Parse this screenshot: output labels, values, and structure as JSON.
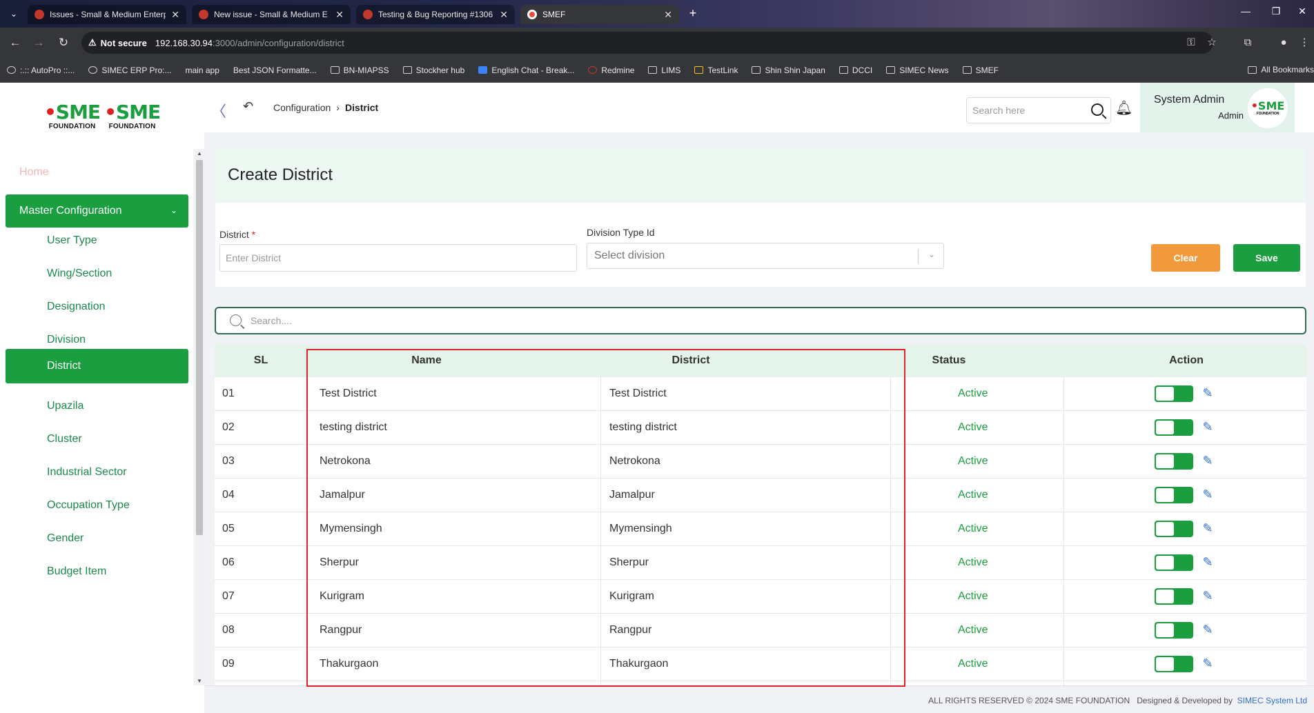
{
  "browser": {
    "tabs": [
      {
        "title": "Issues - Small & Medium Enterp",
        "active": false
      },
      {
        "title": "New issue - Small & Medium E",
        "active": false
      },
      {
        "title": "Testing & Bug Reporting #1306",
        "active": false
      },
      {
        "title": "SMEF",
        "active": true
      }
    ],
    "security_label": "Not secure",
    "url_host": "192.168.30.94",
    "url_path": ":3000/admin/configuration/district",
    "bookmarks": [
      ":.:: AutoPro ::...",
      "SIMEC ERP Pro:...",
      "main app",
      "Best JSON Formatte...",
      "BN-MIAPSS",
      "Stockher hub",
      "English Chat - Break...",
      "Redmine",
      "LIMS",
      "TestLink",
      "Shin Shin Japan",
      "DCCI",
      "SIMEC News",
      "SMEF"
    ],
    "all_bookmarks": "All Bookmarks"
  },
  "logo": {
    "word": "SME",
    "sub": "FOUNDATION"
  },
  "sidebar": {
    "home": "Home",
    "section": "Master Configuration",
    "items": [
      "User Type",
      "Wing/Section",
      "Designation",
      "Division",
      "District",
      "Upazila",
      "Cluster",
      "Industrial Sector",
      "Occupation Type",
      "Gender",
      "Budget Item"
    ],
    "active": "District"
  },
  "header": {
    "breadcrumb_parent": "Configuration",
    "breadcrumb_current": "District",
    "search_placeholder": "Search here",
    "user_name": "System Admin",
    "user_role": "Admin"
  },
  "form": {
    "title": "Create District",
    "district_label": "District",
    "district_required": "*",
    "district_placeholder": "Enter District",
    "division_label": "Division Type Id",
    "division_placeholder": "Select division",
    "clear_label": "Clear",
    "save_label": "Save"
  },
  "table": {
    "search_placeholder": "Search....",
    "headers": {
      "sl": "SL",
      "name": "Name",
      "district": "District",
      "status": "Status",
      "action": "Action"
    },
    "rows": [
      {
        "sl": "01",
        "name": "Test District",
        "district": "Test District",
        "status": "Active"
      },
      {
        "sl": "02",
        "name": "testing district",
        "district": "testing district",
        "status": "Active"
      },
      {
        "sl": "03",
        "name": "Netrokona",
        "district": "Netrokona",
        "status": "Active"
      },
      {
        "sl": "04",
        "name": "Jamalpur",
        "district": "Jamalpur",
        "status": "Active"
      },
      {
        "sl": "05",
        "name": "Mymensingh",
        "district": "Mymensingh",
        "status": "Active"
      },
      {
        "sl": "06",
        "name": "Sherpur",
        "district": "Sherpur",
        "status": "Active"
      },
      {
        "sl": "07",
        "name": "Kurigram",
        "district": "Kurigram",
        "status": "Active"
      },
      {
        "sl": "08",
        "name": "Rangpur",
        "district": "Rangpur",
        "status": "Active"
      },
      {
        "sl": "09",
        "name": "Thakurgaon",
        "district": "Thakurgaon",
        "status": "Active"
      }
    ]
  },
  "footer": {
    "rights": "ALL RIGHTS RESERVED © 2024 SME FOUNDATION",
    "designed": "Designed & Developed by",
    "company": "SIMEC System Ltd"
  },
  "colors": {
    "brand_green": "#1a9e3f",
    "clear_orange": "#f09a3c",
    "highlight_red": "#e0202a"
  }
}
